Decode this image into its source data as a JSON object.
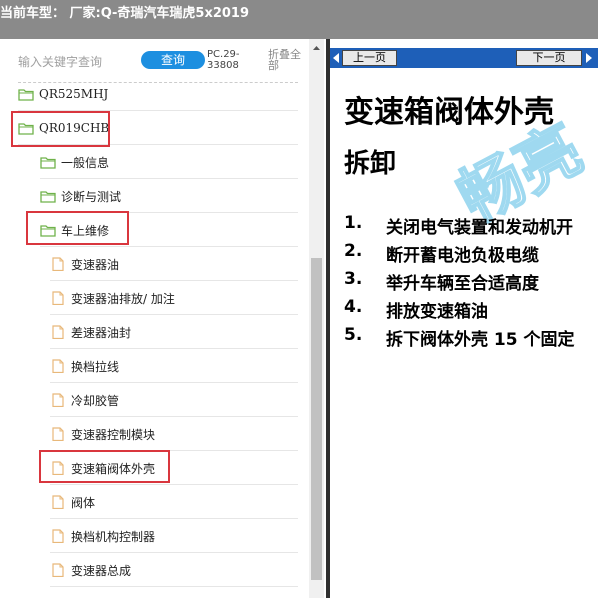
{
  "header": {
    "title": "当前车型：  厂家:Q-奇瑞汽车瑞虎5x2019"
  },
  "search": {
    "placeholder": "输入关键字查询",
    "button_label": "查询",
    "pc_code": "PC.29-33808",
    "collapse_label": "折叠全部"
  },
  "tree": {
    "nodes": [
      {
        "label": "QR525MHJ",
        "type": "folder"
      },
      {
        "label": "QR019CHB",
        "type": "folder"
      },
      {
        "label": "一般信息",
        "type": "folder"
      },
      {
        "label": "诊断与测试",
        "type": "folder"
      },
      {
        "label": "车上维修",
        "type": "folder"
      },
      {
        "label": "变速器油",
        "type": "page"
      },
      {
        "label": "变速器油排放/ 加注",
        "type": "page"
      },
      {
        "label": "差速器油封",
        "type": "page"
      },
      {
        "label": "换档拉线",
        "type": "page"
      },
      {
        "label": "冷却胶管",
        "type": "page"
      },
      {
        "label": "变速器控制模块",
        "type": "page"
      },
      {
        "label": "变速箱阀体外壳",
        "type": "page"
      },
      {
        "label": "阀体",
        "type": "page"
      },
      {
        "label": "换档机构控制器",
        "type": "page"
      },
      {
        "label": "变速器总成",
        "type": "page"
      }
    ]
  },
  "doc": {
    "prev_label": "上一页",
    "next_label": "下一页",
    "title": "变速箱阀体外壳",
    "subtitle": "拆卸",
    "steps": [
      {
        "num": "1.",
        "text": "关闭电气装置和发动机开"
      },
      {
        "num": "2.",
        "text": "断开蓄电池负极电缆"
      },
      {
        "num": "3.",
        "text": "举升车辆至合适高度"
      },
      {
        "num": "4.",
        "text": "排放变速箱油"
      },
      {
        "num": "5.",
        "text": "拆下阀体外壳 15 个固定"
      }
    ],
    "watermark": "畅亮"
  },
  "colors": {
    "highlight": "#d9363e",
    "folder": "#6fb24a",
    "page": "#e8b87a",
    "accent": "#1d8fe0",
    "navbar": "#1e5fb8"
  }
}
